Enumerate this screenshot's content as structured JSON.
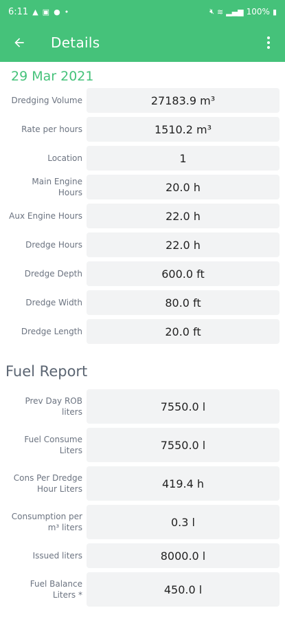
{
  "status": {
    "time": "6:11",
    "battery": "100%"
  },
  "appbar": {
    "title": "Details"
  },
  "date": "29 Mar 2021",
  "details": [
    {
      "label": "Dredging Volume",
      "value": "27183.9 m³"
    },
    {
      "label": "Rate per hours",
      "value": "1510.2 m³"
    },
    {
      "label": "Location",
      "value": "1"
    },
    {
      "label": "Main Engine Hours",
      "value": "20.0 h"
    },
    {
      "label": "Aux Engine Hours",
      "value": "22.0 h"
    },
    {
      "label": "Dredge Hours",
      "value": "22.0 h"
    },
    {
      "label": "Dredge Depth",
      "value": "600.0 ft"
    },
    {
      "label": "Dredge Width",
      "value": "80.0 ft"
    },
    {
      "label": "Dredge Length",
      "value": "20.0 ft"
    }
  ],
  "fuel_section_title": "Fuel Report",
  "fuel": [
    {
      "label": "Prev Day ROB liters",
      "value": "7550.0 l"
    },
    {
      "label": "Fuel Consume Liters",
      "value": "7550.0 l"
    },
    {
      "label": "Cons Per Dredge Hour Liters",
      "value": "419.4 h"
    },
    {
      "label": "Consumption per m³ liters",
      "value": "0.3 l"
    },
    {
      "label": "Issued liters",
      "value": "8000.0 l"
    },
    {
      "label": "Fuel Balance Liters *",
      "value": "450.0 l"
    }
  ],
  "icons": {
    "back": "arrow-left-icon",
    "menu": "more-vert-icon"
  },
  "colors": {
    "primary": "#45c27a",
    "field_bg": "#f2f3f4",
    "label": "#6b7380"
  }
}
